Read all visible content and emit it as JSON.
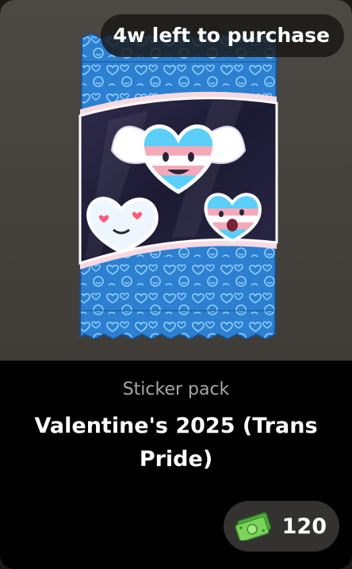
{
  "timer": {
    "text": "4w left to purchase"
  },
  "item": {
    "type_label": "Sticker pack",
    "name": "Valentine's 2025 (Trans Pride)"
  },
  "price": {
    "value": "120",
    "currency_icon": "cash-icon"
  },
  "colors": {
    "pack_blue": "#2f8fde",
    "trans_blue": "#5bcefa",
    "trans_pink": "#f5a9b8",
    "cash_green": "#7ed35a"
  }
}
